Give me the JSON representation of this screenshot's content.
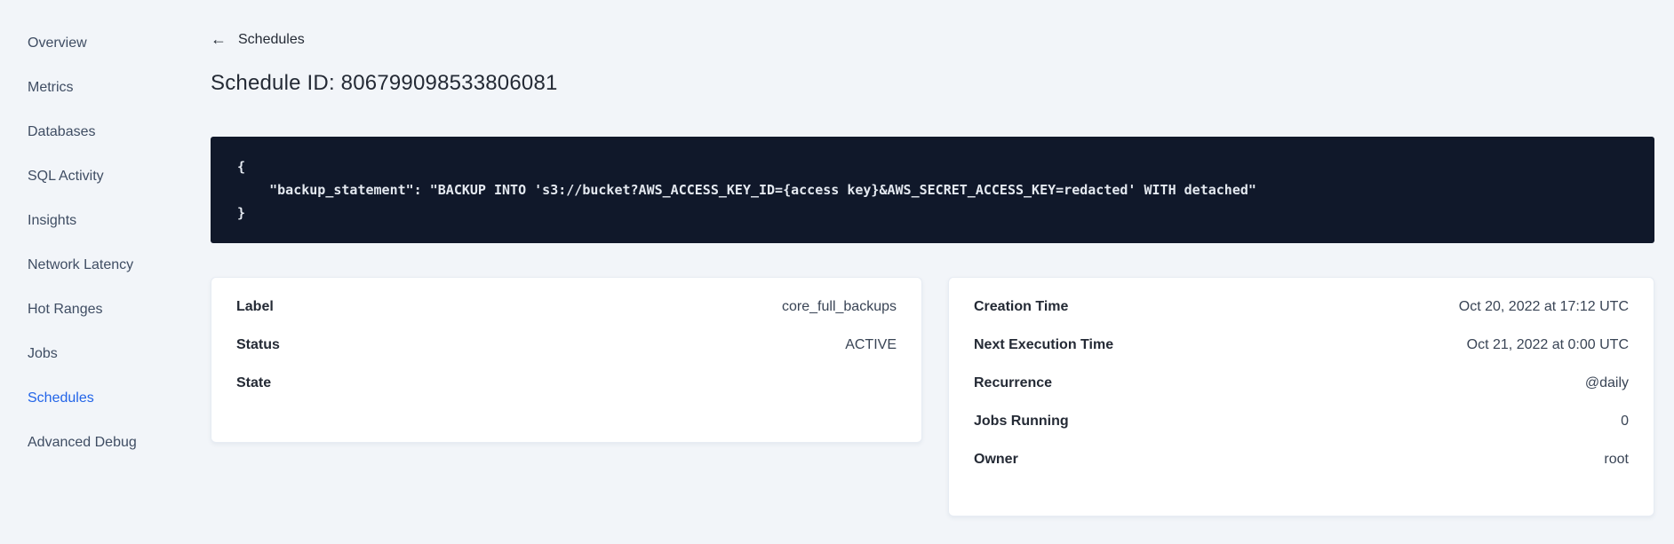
{
  "sidebar": {
    "items": [
      {
        "label": "Overview"
      },
      {
        "label": "Metrics"
      },
      {
        "label": "Databases"
      },
      {
        "label": "SQL Activity"
      },
      {
        "label": "Insights"
      },
      {
        "label": "Network Latency"
      },
      {
        "label": "Hot Ranges"
      },
      {
        "label": "Jobs"
      },
      {
        "label": "Schedules"
      },
      {
        "label": "Advanced Debug"
      }
    ],
    "active_item": "Schedules"
  },
  "header": {
    "back_icon": "←",
    "back_label": "Schedules",
    "title": "Schedule ID: 806799098533806081"
  },
  "code_block": {
    "lines": [
      "{",
      "    \"backup_statement\": \"BACKUP INTO 's3://bucket?AWS_ACCESS_KEY_ID={access key}&AWS_SECRET_ACCESS_KEY=redacted' WITH detached\"",
      "}"
    ]
  },
  "details_card": {
    "rows": [
      {
        "label": "Label",
        "value": "core_full_backups"
      },
      {
        "label": "Status",
        "value": "ACTIVE"
      },
      {
        "label": "State",
        "value": ""
      }
    ]
  },
  "schedule_card": {
    "rows": [
      {
        "label": "Creation Time",
        "value": "Oct 20, 2022 at 17:12 UTC"
      },
      {
        "label": "Next Execution Time",
        "value": "Oct 21, 2022 at 0:00 UTC"
      },
      {
        "label": "Recurrence",
        "value": "@daily"
      },
      {
        "label": "Jobs Running",
        "value": "0"
      },
      {
        "label": "Owner",
        "value": "root"
      }
    ]
  },
  "colors": {
    "page_background": "#f2f5f9",
    "accent_blue": "#2264e8",
    "code_background": "#10182a",
    "code_text": "#e4e9f0",
    "text_dark": "#242a35",
    "sidebar_text": "#3f4d63",
    "card_background": "#ffffff"
  }
}
